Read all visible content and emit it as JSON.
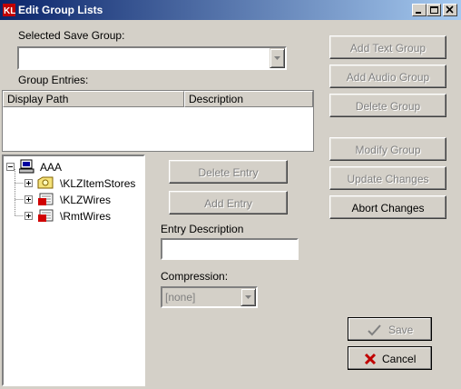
{
  "window": {
    "title": "Edit Group Lists"
  },
  "save_group": {
    "label": "Selected Save Group:",
    "value": ""
  },
  "entries": {
    "label": "Group Entries:",
    "columns": [
      "Display Path",
      "Description"
    ]
  },
  "tree": {
    "root": "AAA",
    "children": [
      "\\KLZItemStores",
      "\\KLZWires",
      "\\RmtWires"
    ]
  },
  "actions": {
    "delete_entry": "Delete Entry",
    "add_entry": "Add Entry"
  },
  "entry_description": {
    "label": "Entry Description",
    "value": ""
  },
  "compression": {
    "label": "Compression:",
    "value": "[none]"
  },
  "right_buttons": {
    "add_text_group": "Add Text Group",
    "add_audio_group": "Add Audio Group",
    "delete_group": "Delete Group",
    "modify_group": "Modify Group",
    "update_changes": "Update Changes",
    "abort_changes": "Abort Changes"
  },
  "bottom_buttons": {
    "save": "Save",
    "cancel": "Cancel"
  }
}
